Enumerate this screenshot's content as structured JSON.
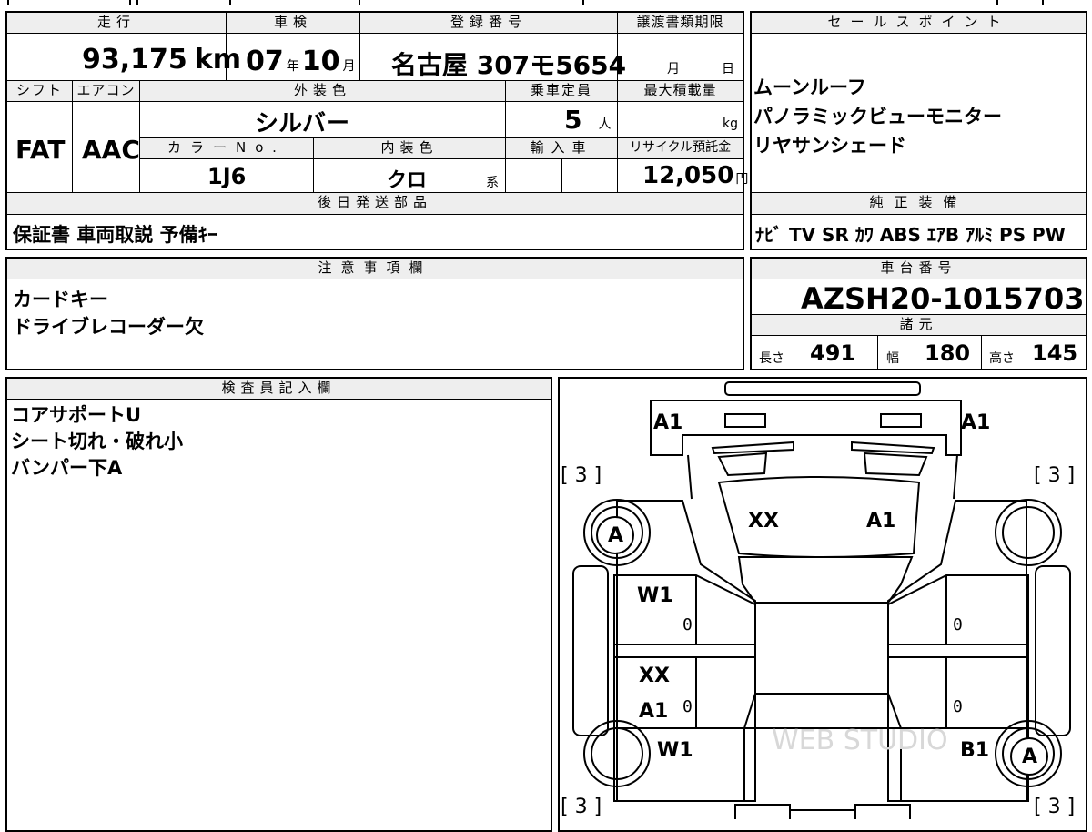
{
  "mileage": {
    "label": "走行",
    "value": "93,175",
    "unit": "km"
  },
  "inspection": {
    "label": "車検",
    "year": "07",
    "year_unit": "年",
    "month": "10",
    "month_unit": "月"
  },
  "registration": {
    "label": "登録番号",
    "value": "名古屋 307モ5654"
  },
  "transfer_deadline": {
    "label": "譲渡書類期限",
    "month_unit": "月",
    "day_unit": "日"
  },
  "shift": {
    "label": "シフト",
    "value": "FAT"
  },
  "aircon": {
    "label": "エアコン",
    "value": "AAC"
  },
  "exterior_color": {
    "label": "外装色",
    "value": "シルバー"
  },
  "capacity": {
    "label": "乗車定員",
    "value": "5",
    "unit": "人"
  },
  "max_load": {
    "label": "最大積載量",
    "unit": "kg"
  },
  "color_no": {
    "label": "カラーNo.",
    "value": "1J6"
  },
  "interior_color": {
    "label": "内装色",
    "value": "クロ",
    "suffix": "系"
  },
  "import": {
    "label": "輸入車"
  },
  "recycle": {
    "label": "リサイクル預託金",
    "value": "12,050",
    "unit": "円"
  },
  "later_parts": {
    "label": "後日発送部品",
    "value": "保証書  車両取説  予備ｷｰ"
  },
  "sales_points": {
    "label": "セールスポイント",
    "items": [
      "ムーンルーフ",
      "パノラミックビューモニター",
      "リヤサンシェード"
    ]
  },
  "equipment": {
    "label": "純正装備",
    "value": "ﾅﾋﾞ TV SR ｶﾜ ABS ｴｱB ｱﾙﾐ PS PW"
  },
  "notes": {
    "label": "注意事項欄",
    "items": [
      "カードキー",
      "ドライブレコーダー欠"
    ]
  },
  "chassis": {
    "label": "車台番号",
    "value": "AZSH20-1015703"
  },
  "specs": {
    "label": "諸元",
    "length_label": "長さ",
    "length": "491",
    "width_label": "幅",
    "width": "180",
    "height_label": "高さ",
    "height": "145"
  },
  "inspector": {
    "label": "検査員記入欄",
    "items": [
      "コアサポートU",
      "シート切れ・破れ小",
      "バンパー下A"
    ]
  },
  "diagram": {
    "a1_front_left": "A1",
    "a1_front_right": "A1",
    "bracket_3": "[ 3 ]",
    "tire_a": "A",
    "hood_left": "XX",
    "hood_right": "A1",
    "w1_front": "W1",
    "door_rear_xx": "XX",
    "door_rear_a1": "A1",
    "w1_rear": "W1",
    "b1_rear": "B1",
    "zero": "0",
    "watermark": "WEB STUDIO"
  }
}
